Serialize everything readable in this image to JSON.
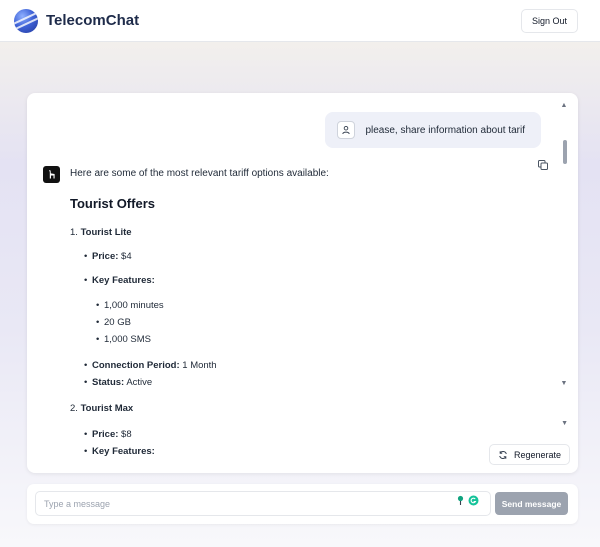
{
  "header": {
    "brand": "TelecomChat",
    "sign_out": "Sign Out"
  },
  "user_message": {
    "text": "please, share information about tarif"
  },
  "bot_message": {
    "intro": "Here are some of the most relevant tariff options available:",
    "heading": "Tourist Offers",
    "tiers": [
      {
        "number": "1.",
        "name": "Tourist Lite",
        "price_label": "Price:",
        "price_value": "$4",
        "features_label": "Key Features:",
        "features": [
          "1,000 minutes",
          "20 GB",
          "1,000 SMS"
        ],
        "period_label": "Connection Period:",
        "period_value": "1 Month",
        "status_label": "Status:",
        "status_value": "Active"
      },
      {
        "number": "2.",
        "name": "Tourist Max",
        "price_label": "Price:",
        "price_value": "$8",
        "features_label": "Key Features:"
      }
    ]
  },
  "actions": {
    "regenerate": "Regenerate"
  },
  "composer": {
    "placeholder": "Type a message",
    "send": "Send message"
  },
  "icons": {
    "logo": "globe-logo-icon",
    "user": "user-icon",
    "bot": "llama-bot-icon",
    "copy": "copy-icon",
    "regenerate": "refresh-icon"
  },
  "colors": {
    "brand_text": "#1e2b4a",
    "user_bubble": "#eef0f8",
    "send_button": "#9ca3af"
  }
}
